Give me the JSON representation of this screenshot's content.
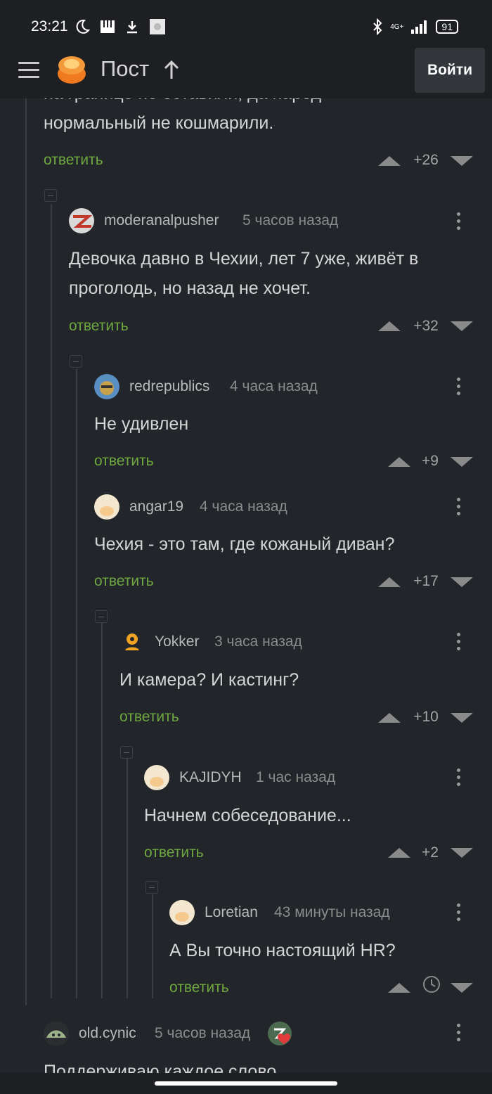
{
  "status": {
    "time": "23:21",
    "network": "4G+",
    "battery": "91"
  },
  "header": {
    "title": "Пост",
    "login": "Войти"
  },
  "top_comment": {
    "text_partial": "на границе не оставили, да народ",
    "text_line": "нормальный не кошмарили.",
    "reply": "ответить",
    "score": "+26"
  },
  "comments": [
    {
      "author": "moderanalpusher",
      "time": "5 часов назад",
      "text1": "Девочка давно в Чехии, лет 7 уже, живёт в",
      "text2": "проголодь, но назад не хочет.",
      "reply": "ответить",
      "score": "+32"
    },
    {
      "author": "redrepublics",
      "time": "4 часа назад",
      "text1": "Не удивлен",
      "reply": "ответить",
      "score": "+9"
    },
    {
      "author": "angar19",
      "time": "4 часа назад",
      "text1": "Чехия - это там, где кожаный диван?",
      "reply": "ответить",
      "score": "+17"
    },
    {
      "author": "Yokker",
      "time": "3 часа назад",
      "text1": "И камера? И кастинг?",
      "reply": "ответить",
      "score": "+10"
    },
    {
      "author": "KAJIDYH",
      "time": "1 час назад",
      "text1": "Начнем собеседование...",
      "reply": "ответить",
      "score": "+2"
    },
    {
      "author": "Loretian",
      "time": "43 минуты назад",
      "text1": "А Вы точно настоящий HR?",
      "reply": "ответить",
      "score": ""
    },
    {
      "author": "old.cynic",
      "time": "5 часов назад",
      "text1": "Поддерживаю каждое слово"
    }
  ],
  "colors": {
    "background": "#222529",
    "reply": "#6fa840",
    "bar": "#1d1f22"
  }
}
